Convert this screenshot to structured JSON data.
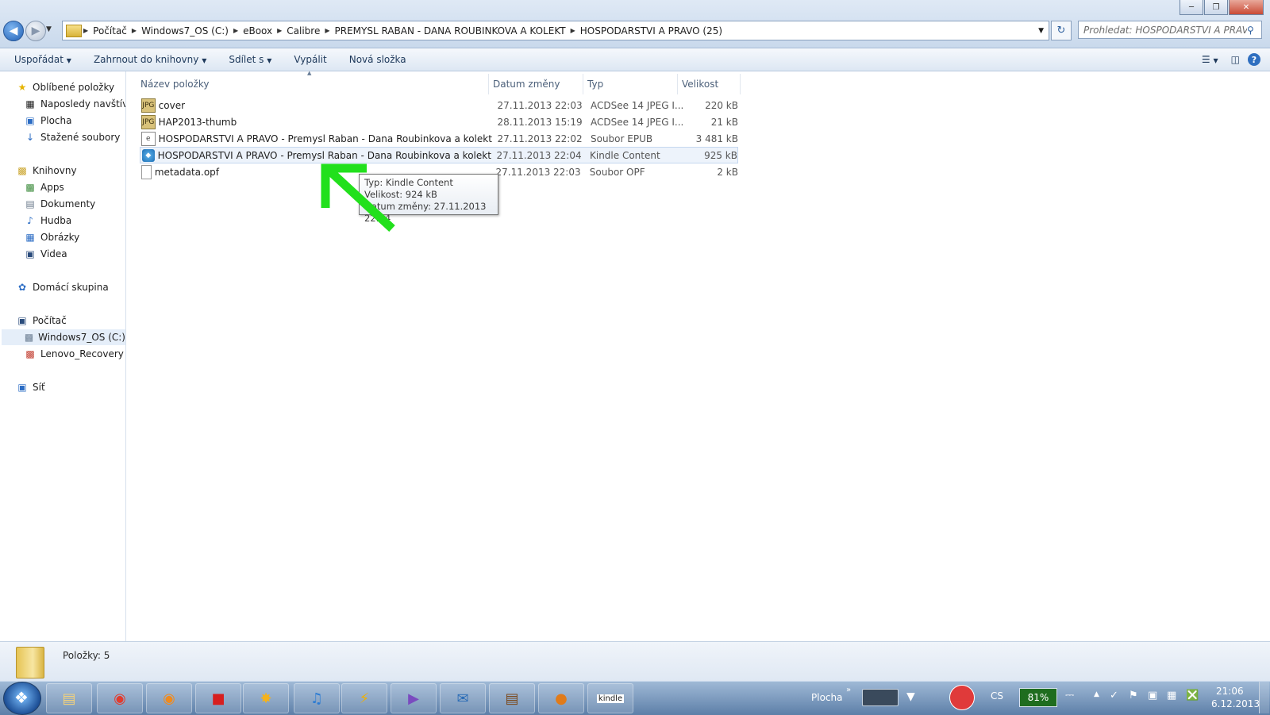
{
  "breadcrumb": [
    "Počítač",
    "Windows7_OS (C:)",
    "eBoox",
    "Calibre",
    "PREMYSL RABAN - DANA ROUBINKOVA A KOLEKT",
    "HOSPODARSTVI A PRAVO (25)"
  ],
  "search": {
    "placeholder": "Prohledat: HOSPODARSTVI A PRAVO ..."
  },
  "toolbar": {
    "organize": "Uspořádat",
    "include_library": "Zahrnout do knihovny",
    "share": "Sdílet s",
    "burn": "Vypálit",
    "new_folder": "Nová složka"
  },
  "sidebar": {
    "favorites": "Oblíbené položky",
    "recent": "Naposledy navštíven",
    "desktop": "Plocha",
    "downloads": "Stažené soubory",
    "libraries": "Knihovny",
    "apps": "Apps",
    "documents": "Dokumenty",
    "music": "Hudba",
    "pictures": "Obrázky",
    "videos": "Videa",
    "homegroup": "Domácí skupina",
    "computer": "Počítač",
    "drive_c": "Windows7_OS (C:)",
    "recovery": "Lenovo_Recovery (Q",
    "network": "Síť"
  },
  "columns": {
    "name": "Název položky",
    "date": "Datum změny",
    "type": "Typ",
    "size": "Velikost"
  },
  "files": [
    {
      "name": "cover",
      "date": "27.11.2013 22:03",
      "type": "ACDSee 14 JPEG I...",
      "size": "220 kB",
      "icon": "jpeg-icon"
    },
    {
      "name": "HAP2013-thumb",
      "date": "28.11.2013 15:19",
      "type": "ACDSee 14 JPEG I...",
      "size": "21 kB",
      "icon": "jpeg-icon"
    },
    {
      "name": "HOSPODARSTVI A PRAVO - Premysl Raban - Dana Roubinkova a kolekt",
      "date": "27.11.2013 22:02",
      "type": "Soubor EPUB",
      "size": "3 481 kB",
      "icon": "epub-icon"
    },
    {
      "name": "HOSPODARSTVI A PRAVO - Premysl Raban - Dana Roubinkova a kolekt",
      "date": "27.11.2013 22:04",
      "type": "Kindle Content",
      "size": "925 kB",
      "icon": "kindle-icon"
    },
    {
      "name": "metadata.opf",
      "date": "27.11.2013 22:03",
      "type": "Soubor OPF",
      "size": "2 kB",
      "icon": "file-icon"
    }
  ],
  "tooltip": {
    "type": "Typ: Kindle Content",
    "size": "Velikost: 924 kB",
    "date": "Datum změny: 27.11.2013 22:04"
  },
  "details": {
    "items_count": "Položky: 5"
  },
  "taskbar": {
    "desktop_label": "Plocha",
    "language": "CS",
    "battery": "81%",
    "time": "21:06",
    "date": "6.12.2013"
  },
  "colors": {
    "arrow": "#22e01c",
    "selection": "#edf3fb"
  }
}
